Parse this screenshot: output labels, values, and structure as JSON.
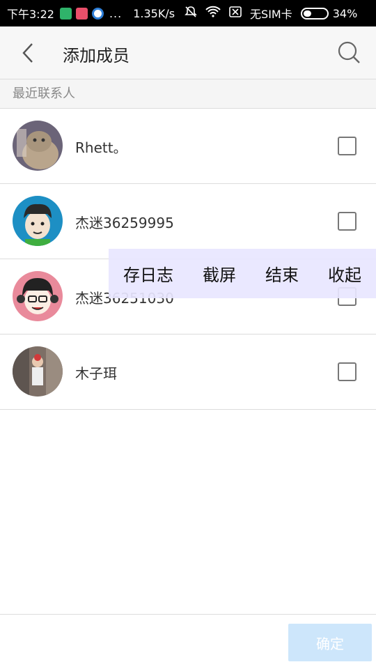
{
  "status_bar": {
    "time": "下午3:22",
    "dots": "...",
    "net_speed": "1.35K/s",
    "sim": "无SIM卡",
    "battery": "34%"
  },
  "appbar": {
    "title": "添加成员"
  },
  "section": {
    "header": "最近联系人"
  },
  "contacts": [
    {
      "name": "Rhett。",
      "checked": false
    },
    {
      "name": "杰迷36259995",
      "checked": false
    },
    {
      "name": "杰迷36251030",
      "checked": false
    },
    {
      "name": "木子珥",
      "checked": false
    }
  ],
  "debug_overlay": {
    "save_log": "存日志",
    "screenshot": "截屏",
    "end": "结束",
    "collapse": "收起"
  },
  "footer": {
    "confirm": "确定"
  }
}
